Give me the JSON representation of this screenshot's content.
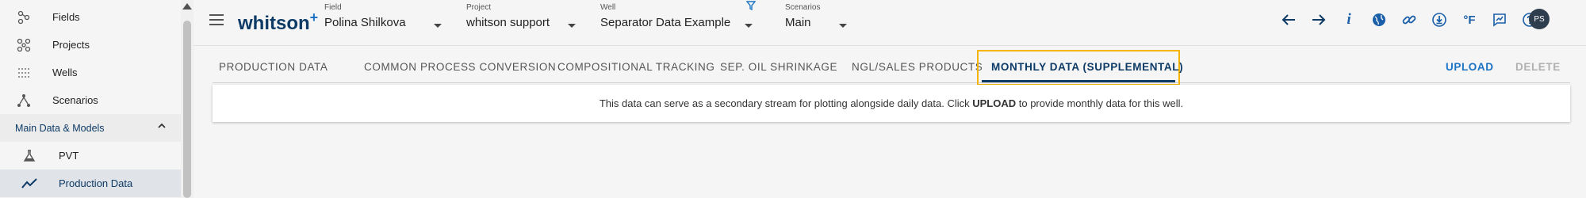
{
  "sidebar": {
    "items": [
      {
        "label": "Fields",
        "icon": "fields-icon"
      },
      {
        "label": "Projects",
        "icon": "projects-icon"
      },
      {
        "label": "Wells",
        "icon": "wells-icon"
      },
      {
        "label": "Scenarios",
        "icon": "scenarios-icon"
      }
    ],
    "section": {
      "label": "Main Data & Models"
    },
    "sub_items": [
      {
        "label": "PVT",
        "icon": "flask-icon"
      },
      {
        "label": "Production Data",
        "icon": "trend-icon",
        "active": true
      }
    ]
  },
  "header": {
    "logo": "whitson",
    "logo_plus": "+",
    "field": {
      "label": "Field",
      "value": "Polina Shilkova"
    },
    "project": {
      "label": "Project",
      "value": "whitson support"
    },
    "well": {
      "label": "Well",
      "value": "Separator Data Example"
    },
    "scenarios": {
      "label": "Scenarios",
      "value": "Main"
    },
    "avatar": "PS",
    "icons": [
      "back-arrow-icon",
      "forward-arrow-icon",
      "info-icon",
      "globe-icon",
      "link-icon",
      "download-icon",
      "fahrenheit-icon",
      "chart-comment-icon",
      "help-icon"
    ],
    "fahrenheit_text": "°F",
    "info_text": "i"
  },
  "tabs": [
    {
      "label": "PRODUCTION DATA"
    },
    {
      "label": "COMMON PROCESS CONVERSION"
    },
    {
      "label": "COMPOSITIONAL TRACKING"
    },
    {
      "label": "SEP. OIL SHRINKAGE"
    },
    {
      "label": "NGL/SALES PRODUCTS"
    },
    {
      "label": "MONTHLY DATA (SUPPLEMENTAL)",
      "active": true
    }
  ],
  "actions": {
    "upload": "UPLOAD",
    "delete": "DELETE"
  },
  "colors": {
    "accent": "#0d3b66",
    "link": "#1a73c4",
    "highlight": "#f5b400",
    "disabled": "#b0b0b0"
  },
  "message": {
    "before": "This data can serve as a secondary stream for plotting alongside daily data. Click ",
    "bold": "UPLOAD",
    "after": " to provide monthly data for this well."
  }
}
